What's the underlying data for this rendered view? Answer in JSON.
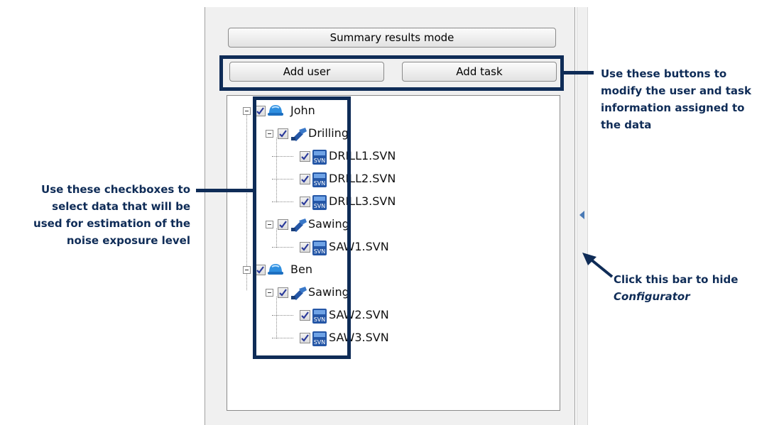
{
  "toolbar": {
    "summary_button": "Summary results mode",
    "add_user_button": "Add user",
    "add_task_button": "Add task"
  },
  "tree": {
    "users": [
      {
        "name": "John",
        "checked": true,
        "icon": "hard-hat-icon",
        "tasks": [
          {
            "name": "Drilling",
            "checked": true,
            "icon": "drill-icon",
            "files": [
              "DRILL1.SVN",
              "DRILL2.SVN",
              "DRILL3.SVN"
            ]
          },
          {
            "name": "Sawing",
            "checked": true,
            "icon": "drill-icon",
            "files": [
              "SAW1.SVN"
            ]
          }
        ]
      },
      {
        "name": "Ben",
        "checked": true,
        "icon": "hard-hat-icon",
        "tasks": [
          {
            "name": "Sawing",
            "checked": true,
            "icon": "drill-icon",
            "files": [
              "SAW2.SVN",
              "SAW3.SVN"
            ]
          }
        ]
      }
    ]
  },
  "annotations": {
    "buttons_note": [
      "Use these buttons to",
      "modify the user and task",
      "information assigned to",
      "the data"
    ],
    "checkbox_note": [
      "Use these checkboxes to",
      "select data that will be",
      "used for estimation of the",
      "noise exposure level"
    ],
    "bar_note_line1": "Click this bar to hide",
    "bar_note_line2": "Configurator"
  },
  "colors": {
    "annotation": "#0f2c57",
    "hat": "#2f8fe0",
    "svn_icon": "#2456a6"
  }
}
